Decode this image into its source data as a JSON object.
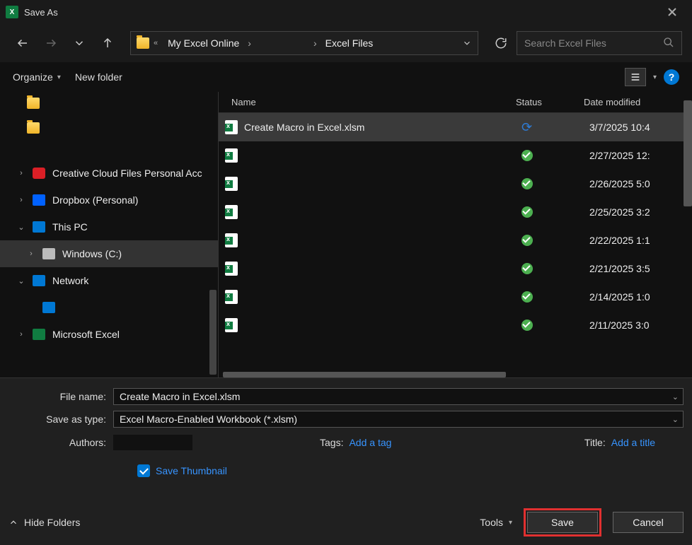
{
  "window": {
    "title": "Save As"
  },
  "breadcrumb": {
    "seg1": "My Excel Online",
    "seg2": "Excel Files"
  },
  "search": {
    "placeholder": "Search Excel Files"
  },
  "toolbar": {
    "organize": "Organize",
    "new_folder": "New folder"
  },
  "sidebar": {
    "items": [
      {
        "label": ""
      },
      {
        "label": ""
      },
      {
        "label": "Creative Cloud Files Personal Acc"
      },
      {
        "label": "Dropbox (Personal)"
      },
      {
        "label": "This PC"
      },
      {
        "label": "Windows (C:)"
      },
      {
        "label": "Network"
      },
      {
        "label": ""
      },
      {
        "label": "Microsoft Excel"
      }
    ]
  },
  "filelist": {
    "headers": {
      "name": "Name",
      "status": "Status",
      "date": "Date modified"
    },
    "rows": [
      {
        "name": "Create Macro in Excel.xlsm",
        "date": "3/7/2025 10:4"
      },
      {
        "name": "",
        "date": "2/27/2025 12:"
      },
      {
        "name": "",
        "date": "2/26/2025 5:0"
      },
      {
        "name": "",
        "date": "2/25/2025 3:2"
      },
      {
        "name": "",
        "date": "2/22/2025 1:1"
      },
      {
        "name": "",
        "date": "2/21/2025 3:5"
      },
      {
        "name": "",
        "date": "2/14/2025 1:0"
      },
      {
        "name": "",
        "date": "2/11/2025 3:0"
      }
    ]
  },
  "form": {
    "filename_label": "File name:",
    "filename_value": "Create Macro in Excel.xlsm",
    "type_label": "Save as type:",
    "type_value": "Excel Macro-Enabled Workbook (*.xlsm)",
    "authors_label": "Authors:",
    "tags_label": "Tags:",
    "tags_link": "Add a tag",
    "title_label": "Title:",
    "title_link": "Add a title",
    "thumb_label": "Save Thumbnail"
  },
  "footer": {
    "hide_folders": "Hide Folders",
    "tools": "Tools",
    "save": "Save",
    "cancel": "Cancel"
  }
}
